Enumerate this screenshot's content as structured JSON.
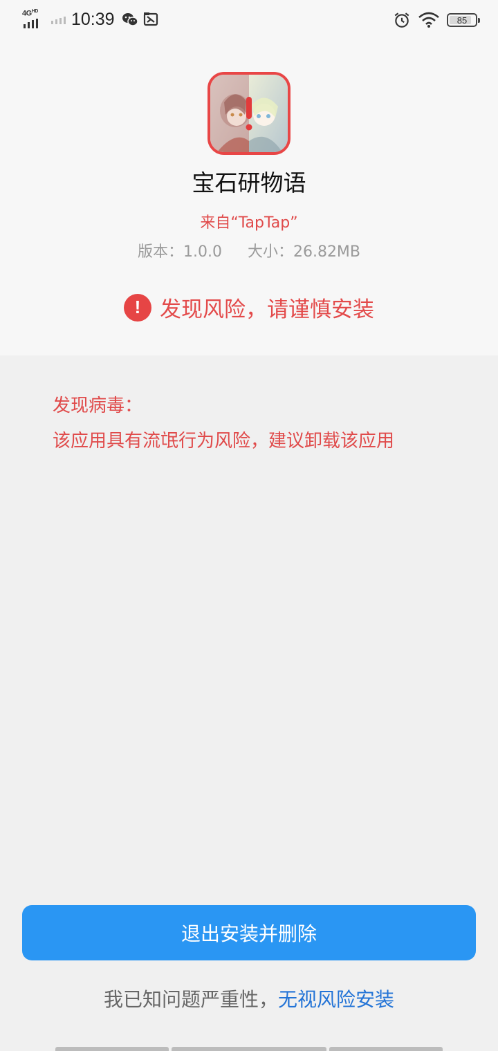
{
  "status_bar": {
    "network": "4G",
    "network_hd": "HD",
    "time": "10:39",
    "battery": "85",
    "battery_level": 0.85,
    "icons_left": [
      "wechat-icon",
      "image-app-icon"
    ],
    "icons_right": [
      "alarm-icon",
      "wifi-icon",
      "battery-icon"
    ]
  },
  "app": {
    "name": "宝石研物语",
    "source": "来自“TapTap”",
    "version": "版本：1.0.0",
    "size": "大小：26.82MB",
    "icon": "app-icon-with-warning"
  },
  "risk": {
    "icon": "exclamation-circle-icon",
    "icon_glyph": "!",
    "title": "发现风险，请谨慎安装"
  },
  "virus": {
    "title": "发现病毒：",
    "description": "该应用具有流氓行为风险，建议卸载该应用"
  },
  "actions": {
    "primary": "退出安装并删除",
    "ignore_prefix": "我已知问题严重性，",
    "ignore_link": "无视风险安装"
  },
  "colors": {
    "warning_red": "#e34a4a",
    "primary_blue": "#2a96f3",
    "link_blue": "#2273d6"
  }
}
